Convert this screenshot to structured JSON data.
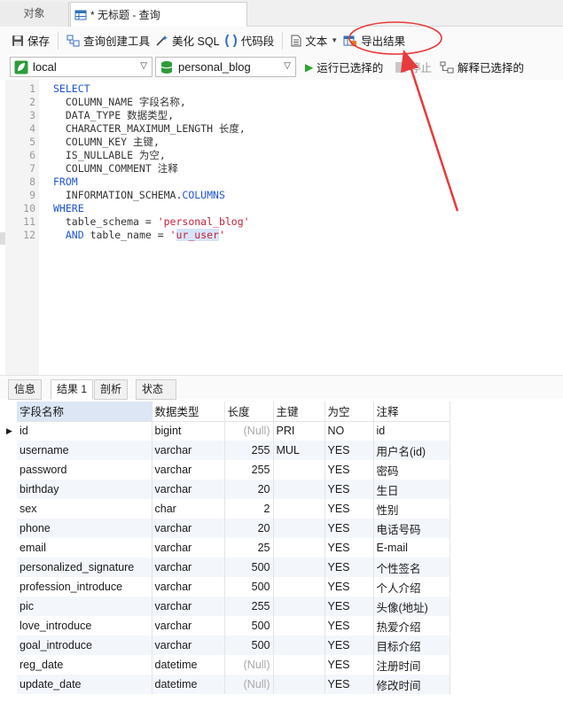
{
  "tabs": {
    "objects": "对象",
    "query": "* 无标题 - 查询"
  },
  "toolbar": {
    "save": "保存",
    "query_builder": "查询创建工具",
    "beautify": "美化 SQL",
    "snippet": "代码段",
    "text": "文本",
    "export": "导出结果"
  },
  "selectors": {
    "connection": "local",
    "database": "personal_blog",
    "run_selected": "运行已选择的",
    "stop": "停止",
    "explain": "解释已选择的"
  },
  "editor": {
    "lines": [
      {
        "n": "1",
        "parts": [
          {
            "t": "SELECT",
            "c": "kw"
          }
        ]
      },
      {
        "n": "2",
        "parts": [
          {
            "t": "  COLUMN_NAME 字段名称,",
            "c": ""
          }
        ]
      },
      {
        "n": "3",
        "parts": [
          {
            "t": "  DATA_TYPE 数据类型,",
            "c": ""
          }
        ]
      },
      {
        "n": "4",
        "parts": [
          {
            "t": "  CHARACTER_MAXIMUM_LENGTH 长度,",
            "c": ""
          }
        ]
      },
      {
        "n": "5",
        "parts": [
          {
            "t": "  COLUMN_KEY 主键,",
            "c": ""
          }
        ]
      },
      {
        "n": "6",
        "parts": [
          {
            "t": "  IS_NULLABLE 为空,",
            "c": ""
          }
        ]
      },
      {
        "n": "7",
        "parts": [
          {
            "t": "  COLUMN_COMMENT 注释",
            "c": ""
          }
        ]
      },
      {
        "n": "8",
        "parts": [
          {
            "t": "FROM",
            "c": "kw"
          }
        ]
      },
      {
        "n": "9",
        "parts": [
          {
            "t": "  INFORMATION_SCHEMA.",
            "c": ""
          },
          {
            "t": "COLUMNS",
            "c": "kw"
          }
        ]
      },
      {
        "n": "10",
        "parts": [
          {
            "t": "WHERE",
            "c": "kw"
          }
        ]
      },
      {
        "n": "11",
        "parts": [
          {
            "t": "  table_schema = ",
            "c": ""
          },
          {
            "t": "'personal_blog'",
            "c": "str"
          }
        ]
      },
      {
        "n": "12",
        "parts": [
          {
            "t": "  ",
            "c": ""
          },
          {
            "t": "AND",
            "c": "kw"
          },
          {
            "t": " table_name = ",
            "c": ""
          },
          {
            "t": "'",
            "c": "str"
          },
          {
            "t": "ur_user",
            "c": "str hl"
          },
          {
            "t": "'",
            "c": "str"
          }
        ]
      }
    ]
  },
  "result_tabs": [
    "信息",
    "结果 1",
    "剖析",
    "状态"
  ],
  "grid": {
    "headers": [
      "字段名称",
      "数据类型",
      "长度",
      "主键",
      "为空",
      "注释"
    ],
    "rows": [
      [
        "id",
        "bigint",
        "(Null)",
        "PRI",
        "NO",
        "id"
      ],
      [
        "username",
        "varchar",
        "255",
        "MUL",
        "YES",
        "用户名(id)"
      ],
      [
        "password",
        "varchar",
        "255",
        "",
        "YES",
        "密码"
      ],
      [
        "birthday",
        "varchar",
        "20",
        "",
        "YES",
        "生日"
      ],
      [
        "sex",
        "char",
        "2",
        "",
        "YES",
        "性别"
      ],
      [
        "phone",
        "varchar",
        "20",
        "",
        "YES",
        "电话号码"
      ],
      [
        "email",
        "varchar",
        "25",
        "",
        "YES",
        "E-mail"
      ],
      [
        "personalized_signature",
        "varchar",
        "500",
        "",
        "YES",
        "个性签名"
      ],
      [
        "profession_introduce",
        "varchar",
        "500",
        "",
        "YES",
        "个人介绍"
      ],
      [
        "pic",
        "varchar",
        "255",
        "",
        "YES",
        "头像(地址)"
      ],
      [
        "love_introduce",
        "varchar",
        "500",
        "",
        "YES",
        "热爱介绍"
      ],
      [
        "goal_introduce",
        "varchar",
        "500",
        "",
        "YES",
        "目标介绍"
      ],
      [
        "reg_date",
        "datetime",
        "(Null)",
        "",
        "YES",
        "注册时间"
      ],
      [
        "update_date",
        "datetime",
        "(Null)",
        "",
        "YES",
        "修改时间"
      ]
    ]
  },
  "colors": {
    "keyword": "#1f54d6",
    "string": "#c4203a",
    "annotation": "#e83a3a",
    "run_green": "#2aa52a"
  }
}
